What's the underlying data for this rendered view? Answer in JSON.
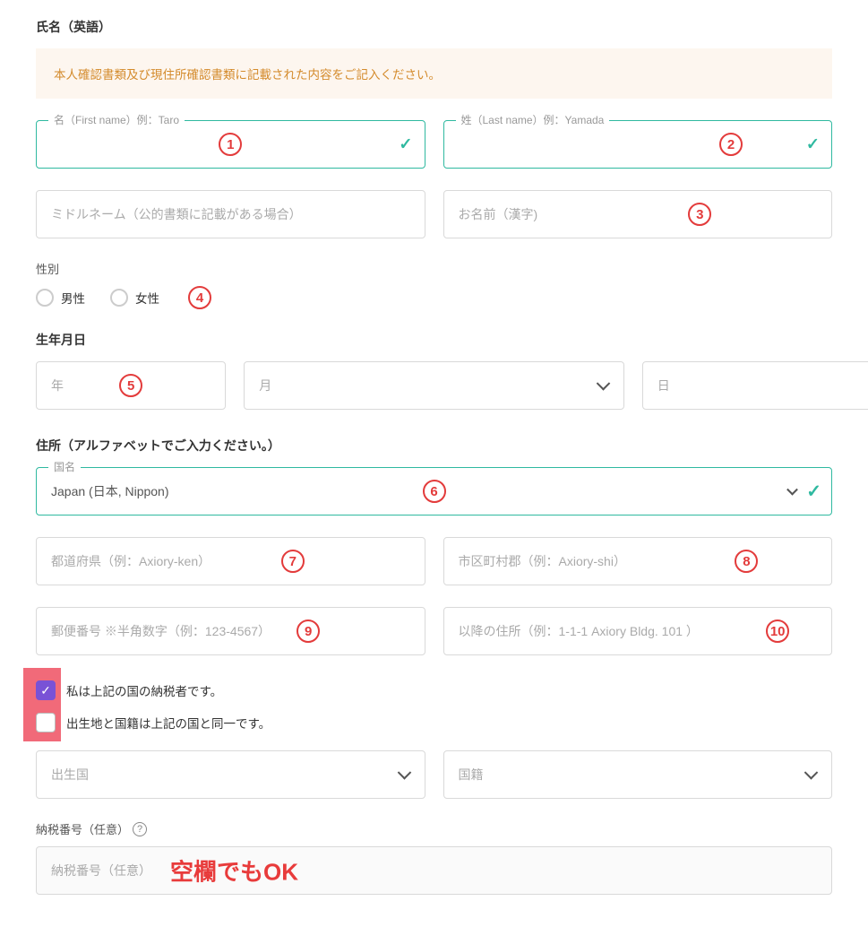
{
  "sections": {
    "name_en": "氏名（英語）",
    "gender": "性別",
    "dob": "生年月日",
    "address": "住所（アルファベットでご入力ください。）",
    "tax_number": "納税番号（任意）"
  },
  "notice": "本人確認書類及び現住所確認書類に記載された内容をご記入ください。",
  "name": {
    "first_label": "名（First name）例：Taro",
    "last_label": "姓（Last name）例：Yamada",
    "middle_placeholder": "ミドルネーム（公的書類に記載がある場合）",
    "kanji_placeholder": "お名前（漢字)"
  },
  "gender": {
    "male": "男性",
    "female": "女性"
  },
  "dob": {
    "year_placeholder": "年",
    "month_placeholder": "月",
    "day_placeholder": "日"
  },
  "country": {
    "label": "国名",
    "value": "Japan (日本, Nippon)"
  },
  "address": {
    "pref_placeholder": "都道府県（例：Axiory-ken）",
    "city_placeholder": "市区町村郡（例：Axiory-shi）",
    "postal_placeholder": "郵便番号 ※半角数字（例：123-4567）",
    "rest_placeholder": "以降の住所（例：1-1-1 Axiory Bldg. 101 ）"
  },
  "checkboxes": {
    "taxpayer": "私は上記の国の納税者です。",
    "birth_nationality": "出生地と国籍は上記の国と同一です。"
  },
  "birth_country_placeholder": "出生国",
  "nationality_placeholder": "国籍",
  "tax": {
    "label": "納税番号（任意）",
    "placeholder": "納税番号（任意）"
  },
  "annotations": {
    "1": "1",
    "2": "2",
    "3": "3",
    "4": "4",
    "5": "5",
    "6": "6",
    "7": "7",
    "8": "8",
    "9": "9",
    "10": "10",
    "blank_ok": "空欄でもOK"
  }
}
